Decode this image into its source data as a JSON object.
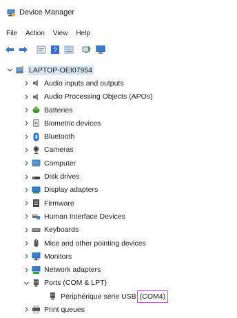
{
  "window": {
    "title": "Device Manager",
    "app_icon": "device-manager-icon"
  },
  "menu": [
    "File",
    "Action",
    "View",
    "Help"
  ],
  "toolbar": [
    {
      "name": "back-arrow-icon"
    },
    {
      "name": "forward-arrow-icon"
    },
    {
      "name": "properties-icon"
    },
    {
      "name": "help-icon"
    },
    {
      "name": "view-list-icon"
    },
    {
      "name": "scan-hardware-icon"
    },
    {
      "name": "monitor-icon"
    }
  ],
  "tree": {
    "root": {
      "label": "LAPTOP-OEI07954",
      "expanded": true
    },
    "categories": [
      {
        "label": "Audio inputs and outputs",
        "icon": "speaker-icon"
      },
      {
        "label": "Audio Processing Objects (APOs)",
        "icon": "speaker-icon"
      },
      {
        "label": "Batteries",
        "icon": "battery-icon"
      },
      {
        "label": "Biometric devices",
        "icon": "fingerprint-icon"
      },
      {
        "label": "Bluetooth",
        "icon": "bluetooth-icon"
      },
      {
        "label": "Cameras",
        "icon": "camera-icon"
      },
      {
        "label": "Computer",
        "icon": "computer-icon"
      },
      {
        "label": "Disk drives",
        "icon": "disk-drive-icon"
      },
      {
        "label": "Display adapters",
        "icon": "display-adapter-icon"
      },
      {
        "label": "Firmware",
        "icon": "firmware-icon"
      },
      {
        "label": "Human Interface Devices",
        "icon": "hid-icon"
      },
      {
        "label": "Keyboards",
        "icon": "keyboard-icon"
      },
      {
        "label": "Mice and other pointing devices",
        "icon": "mouse-icon"
      },
      {
        "label": "Monitors",
        "icon": "monitor-icon"
      },
      {
        "label": "Network adapters",
        "icon": "network-adapter-icon"
      },
      {
        "label": "Ports (COM & LPT)",
        "icon": "port-icon",
        "expanded": true,
        "children": [
          {
            "label": "Périphérique série USB",
            "highlight": "(COM4)",
            "icon": "port-icon"
          }
        ]
      },
      {
        "label": "Print queues",
        "icon": "printer-icon"
      }
    ]
  },
  "colors": {
    "root_selection": "#d9e6f5",
    "highlight_box": "#b65cf2",
    "icon_blue": "#2f7fd6"
  }
}
